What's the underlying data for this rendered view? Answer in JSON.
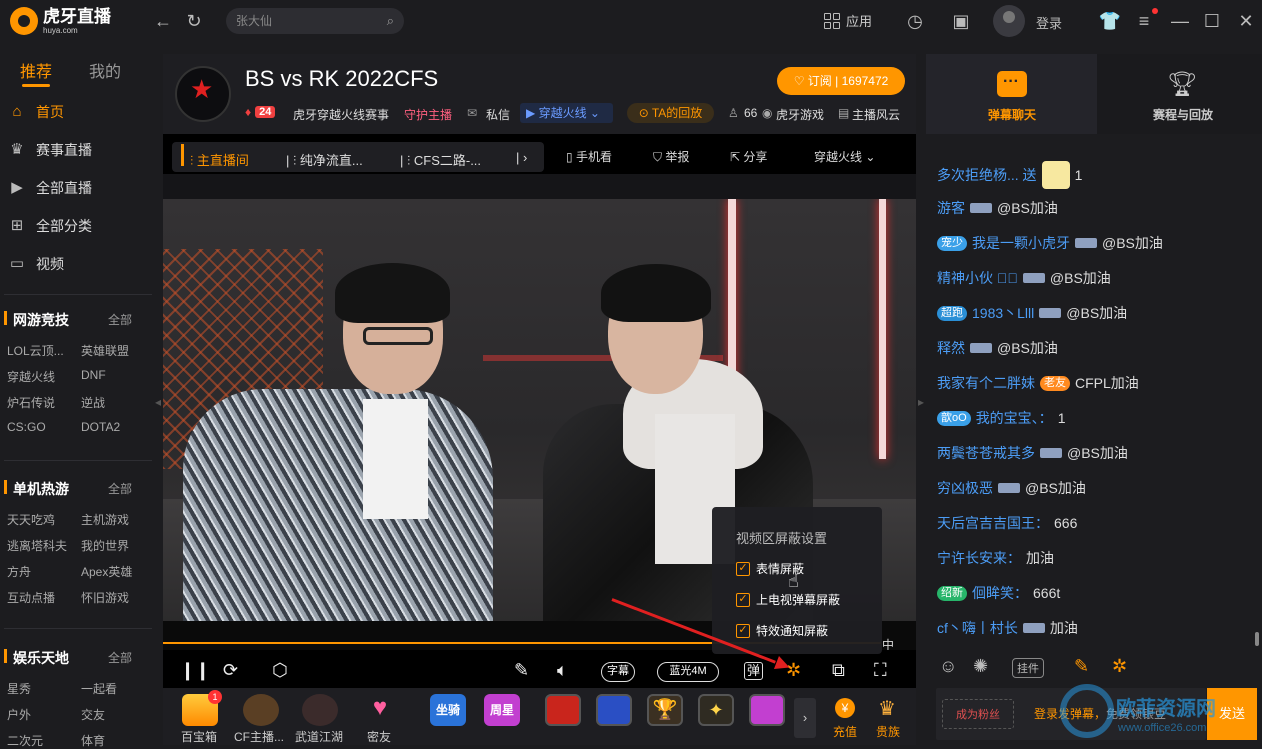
{
  "app": {
    "logo_text": "虎牙直播",
    "logo_sub": "huya.com"
  },
  "topbar": {
    "search_placeholder": "张大仙",
    "apps_label": "应用",
    "login_label": "登录"
  },
  "sidebar": {
    "tab_recommend": "推荐",
    "tab_mine": "我的",
    "nav": [
      {
        "label": "首页",
        "icon": "home-icon"
      },
      {
        "label": "赛事直播",
        "icon": "trophy-icon"
      },
      {
        "label": "全部直播",
        "icon": "play-icon"
      },
      {
        "label": "全部分类",
        "icon": "grid-icon"
      },
      {
        "label": "视频",
        "icon": "tv-icon"
      }
    ],
    "sections": [
      {
        "title": "网游竞技",
        "all": "全部",
        "links": [
          "LOL云顶...",
          "英雄联盟",
          "穿越火线",
          "DNF",
          "炉石传说",
          "逆战",
          "CS:GO",
          "DOTA2"
        ]
      },
      {
        "title": "单机热游",
        "all": "全部",
        "links": [
          "天天吃鸡",
          "主机游戏",
          "逃离塔科夫",
          "我的世界",
          "方舟",
          "Apex英雄",
          "互动点播",
          "怀旧游戏"
        ]
      },
      {
        "title": "娱乐天地",
        "all": "全部",
        "links": [
          "星秀",
          "一起看",
          "户外",
          "交友",
          "二次元",
          "体育"
        ]
      }
    ]
  },
  "room": {
    "title": "BS vs RK 2022CFS",
    "level": "24",
    "category": "虎牙穿越火线赛事",
    "guard": "守护主播",
    "message": "私信",
    "game_tag": "穿越火线",
    "replay": "TA的回放",
    "fans_count": "66",
    "org": "虎牙游戏",
    "host_style": "主播风云",
    "follow_label": "订阅",
    "follow_count": "1697472"
  },
  "player": {
    "lines": [
      "主直播间",
      "纯净流直...",
      "CFS二路-..."
    ],
    "mobile": "手机看",
    "report": "举报",
    "share": "分享",
    "game_dropdown": "穿越火线",
    "subtitle_btn": "字幕",
    "quality": "蓝光4M",
    "danmu_btn": "弹",
    "mid_text": "中"
  },
  "popup": {
    "title": "视频区屏蔽设置",
    "items": [
      "表情屏蔽",
      "上电视弹幕屏蔽",
      "特效通知屏蔽"
    ]
  },
  "gifts": [
    {
      "label": "百宝箱",
      "badge": "1"
    },
    {
      "label": "CF主播..."
    },
    {
      "label": "武道江湖"
    },
    {
      "label": "密友"
    }
  ],
  "gift_extra": {
    "recharge": "充值",
    "noble": "贵族",
    "mount": "坐骑",
    "week_star": "周星"
  },
  "right_panel": {
    "tab_chat": "弹幕聊天",
    "tab_replay": "赛程与回放"
  },
  "chat": [
    {
      "name": "多次拒绝杨... 送",
      "msg": "1",
      "badge": ""
    },
    {
      "name": "游客",
      "msg": "@BS加油",
      "badge": ""
    },
    {
      "name": "我是一颗小虎牙",
      "msg": "@BS加油",
      "badge": "宠少"
    },
    {
      "name": "精神小伙 ڰۣ",
      "msg": "@BS加油",
      "badge": ""
    },
    {
      "name": "1983丶Llll",
      "msg": "@BS加油",
      "badge": "超跑"
    },
    {
      "name": "释然",
      "msg": "@BS加油",
      "badge": ""
    },
    {
      "name": "我家有个二胖妹",
      "msg": "CFPL加油",
      "badge": "老友"
    },
    {
      "name": "我的宝宝、：",
      "msg": "1",
      "badge": "歆oO"
    },
    {
      "name": "两鬓苍苍戒其多",
      "msg": "@BS加油",
      "badge": ""
    },
    {
      "name": "穷凶极恶",
      "msg": "@BS加油",
      "badge": ""
    },
    {
      "name": "天后宫吉吉国王：",
      "msg": "666",
      "badge": ""
    },
    {
      "name": "宁许长安来：",
      "msg": "加油",
      "badge": ""
    },
    {
      "name": "佪眸笑：",
      "msg": "666t",
      "badge": "绍新"
    },
    {
      "name": "cf丶嗨丨村长",
      "msg": "加油",
      "badge": ""
    }
  ],
  "chat_input": {
    "fans_btn": "成为粉丝",
    "login_text": "登录发弹幕，",
    "free_text": "免费领银豆",
    "send": "发送"
  },
  "watermark": {
    "text": "欧菲资源网",
    "url": "www.office26.com"
  },
  "colors": {
    "accent": "#ff9600",
    "name_blue": "#4c9df6",
    "bg": "#1c1c1f"
  }
}
